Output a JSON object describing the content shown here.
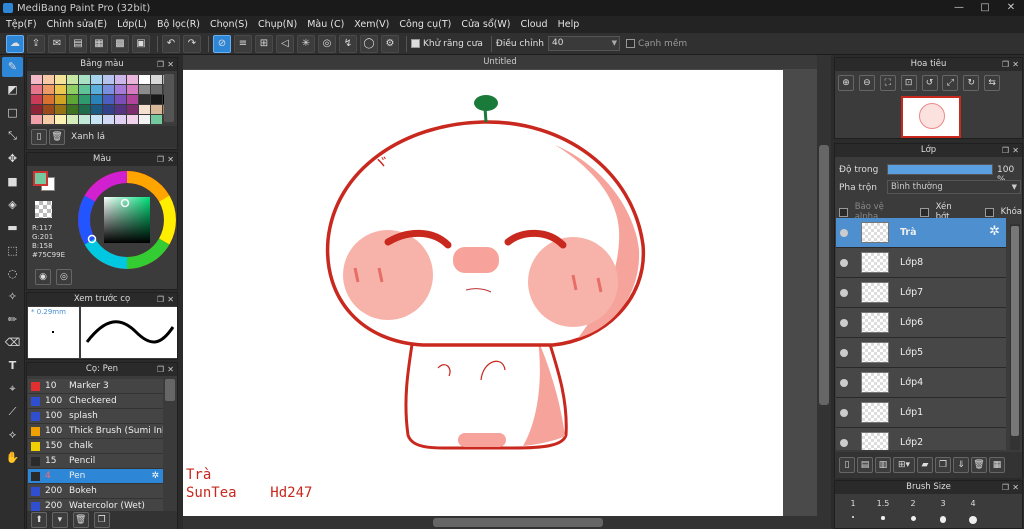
{
  "window": {
    "title": "MediBang Paint Pro (32bit)",
    "min": "—",
    "max": "□",
    "close": "✕"
  },
  "menu": [
    "Tệp(F)",
    "Chỉnh sửa(E)",
    "Lớp(L)",
    "Bộ lọc(R)",
    "Chọn(S)",
    "Chụp(N)",
    "Màu (C)",
    "Xem(V)",
    "Công cụ(T)",
    "Cửa sổ(W)",
    "Cloud",
    "Help"
  ],
  "toolbar": {
    "antialias_label": "Khử răng cưa",
    "adjust_label": "Điều chỉnh",
    "adjust_value": "40",
    "sharp_label": "Cạnh mềm"
  },
  "palette_panel": {
    "title": "Bảng màu",
    "selected_name": "Xanh lá",
    "swatches": [
      "#f4b9c6",
      "#f7c9a6",
      "#f6e39a",
      "#c8e7a4",
      "#a9e1c7",
      "#a7d5ee",
      "#b7c3ef",
      "#cdb6ea",
      "#eab6de",
      "#ffffff",
      "#d8d8d8",
      "#b0b0b0",
      "#e6748b",
      "#ef9a66",
      "#ecc84f",
      "#8fce63",
      "#5fc39a",
      "#5aaedb",
      "#7b8fe0",
      "#a57ad8",
      "#d67ac1",
      "#8c8c8c",
      "#6a6a6a",
      "#474747",
      "#c93b57",
      "#d9702f",
      "#d1a322",
      "#5da534",
      "#2e9b6e",
      "#2a83b8",
      "#4b5fc1",
      "#7b4db7",
      "#b1449b",
      "#2f2f2f",
      "#1a1a1a",
      "#000000",
      "#8e2438",
      "#9c4a1d",
      "#957314",
      "#3e7322",
      "#1e6c4c",
      "#1c5c82",
      "#31428a",
      "#553482",
      "#7c2e6c",
      "#f5e1cf",
      "#d9b89a",
      "#a87e5a",
      "#f0a0a8",
      "#f5cba8",
      "#fdf1b3",
      "#d5edbc",
      "#c1e9d9",
      "#c6e4f4",
      "#d1d9f5",
      "#e0d1f2",
      "#f1d2ea",
      "#f2f2f2",
      "#75c99e",
      "#3d3d3d"
    ]
  },
  "color_panel": {
    "title": "Màu",
    "r": "R:117",
    "g": "G:201",
    "b": "B:158",
    "hex": "#75C99E",
    "fg": "#75c99e",
    "bg": "#ffffff"
  },
  "preview_panel": {
    "title": "Xem trước cọ",
    "size": "* 0.29mm"
  },
  "brush_panel": {
    "title": "Cọ: Pen",
    "brushes": [
      {
        "color": "#e03030",
        "size": "10",
        "name": "Marker 3"
      },
      {
        "color": "#2f4fd0",
        "size": "100",
        "name": "Checkered"
      },
      {
        "color": "#2f4fd0",
        "size": "100",
        "name": "splash"
      },
      {
        "color": "#f0a000",
        "size": "100",
        "name": "Thick Brush (Sumi Ink)"
      },
      {
        "color": "#f0d000",
        "size": "150",
        "name": "chalk"
      },
      {
        "color": "#2a2a2a",
        "size": "15",
        "name": "Pencil"
      },
      {
        "color": "#2a2a2a",
        "size": "4",
        "name": "Pen",
        "selected": true
      },
      {
        "color": "#2f4fd0",
        "size": "200",
        "name": "Bokeh"
      },
      {
        "color": "#2f4fd0",
        "size": "200",
        "name": "Watercolor (Wet)"
      }
    ]
  },
  "canvas": {
    "tab": "Untitled",
    "signature_line1": "Trà",
    "signature_line2": "SunTea    Hd247"
  },
  "navigator": {
    "title": "Hoa tiêu"
  },
  "layer_panel": {
    "title": "Lớp",
    "opacity_label": "Độ trong",
    "opacity_value": "100 %",
    "opacity_fraction": 1.0,
    "blend_label": "Pha trộn",
    "blend_value": "Bình thường",
    "protect_alpha": "Bảo vệ alpha",
    "clipping": "Xén bớt",
    "lock": "Khóa",
    "layers": [
      {
        "name": "Trà",
        "selected": true
      },
      {
        "name": "Lớp8"
      },
      {
        "name": "Lớp7"
      },
      {
        "name": "Lớp6"
      },
      {
        "name": "Lớp5"
      },
      {
        "name": "Lớp4"
      },
      {
        "name": "Lớp1"
      },
      {
        "name": "Lớp2"
      }
    ]
  },
  "brush_size_panel": {
    "title": "Brush Size",
    "sizes": [
      "1",
      "1.5",
      "2",
      "3",
      "4"
    ]
  }
}
